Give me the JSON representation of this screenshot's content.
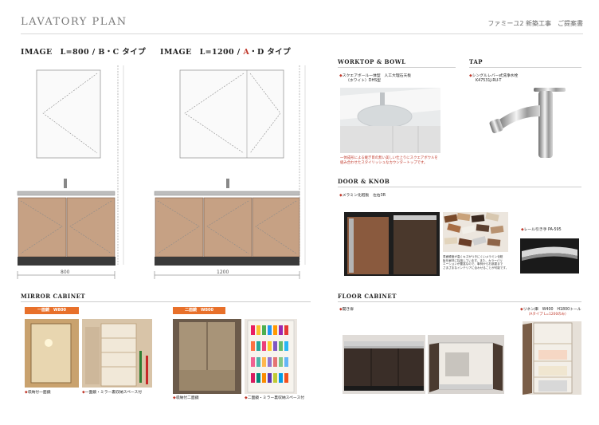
{
  "header": {
    "title": "LAVATORY PLAN",
    "right": "ファミーユ2 新築工事　ご提案書"
  },
  "image_left": {
    "title": "IMAGE　L=800 / B・C タイプ",
    "dimension": "800"
  },
  "image_right": {
    "title_prefix": "IMAGE　L=1200 / ",
    "title_red": "A",
    "title_suffix": "・D タイプ",
    "dimension": "1200"
  },
  "worktop": {
    "title": "WORKTOP & BOWL",
    "caption_line1": "スクエアボール一体型　人工大理石天板",
    "caption_line2": "（ホワイト）DHS型",
    "note_line1": "一体成形による継ぎ目の無い美しい仕上りにスクエアボウルを",
    "note_line2": "組み合わせたスタイリッシュなカウンタートップです。"
  },
  "tap": {
    "title": "TAP",
    "caption_line1": "シングルレバー式洗浄水栓",
    "caption_line2": "K47531J-RU-T"
  },
  "door_knob": {
    "title": "DOOR & KNOB",
    "door_caption": "メラミン化粧板　左右3R",
    "swatch_note_line1": "表面硬度が高くキズがつきにくいメラミン化粧",
    "swatch_note_line2": "板を扉材に採用しています。また、カラーバリ",
    "swatch_note_line3": "エーションが豊富なので、事例からお部屋まで",
    "swatch_note_line4": "さまざまなインテリアに合わせることが可能です。",
    "knob_caption": "レール引き手 PA-595"
  },
  "mirror_cabinet": {
    "title": "MIRROR CABINET",
    "tag_one": "一面鏡　W800",
    "tag_two": "二面鏡　W800",
    "caption_one_a": "収納付一面鏡",
    "caption_one_b": "一面鏡・ミラー裏収納スペース付",
    "caption_two_a": "収納付二面鏡",
    "caption_two_b": "二面鏡・ミラー裏収納スペース付"
  },
  "floor_cabinet": {
    "title": "FLOOR CABINET",
    "caption_open": "開き扉",
    "caption_linen_line1": "リネン庫　W400　H1800トール",
    "caption_linen_line2": "（Aタイプ L=1200のみ）"
  }
}
